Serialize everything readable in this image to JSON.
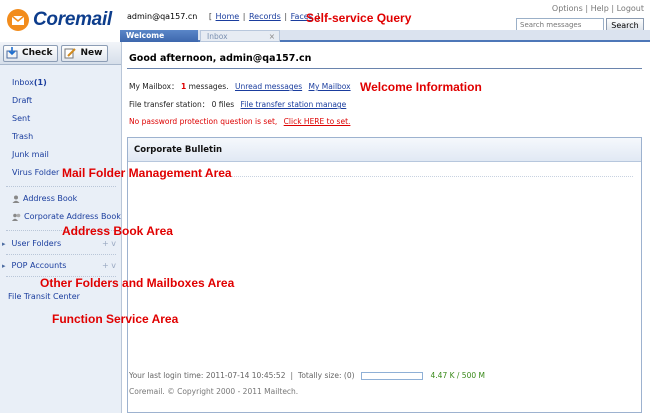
{
  "brand": {
    "name": "Coremail"
  },
  "header": {
    "user": "admin@qa157.cn",
    "links": [
      "Home",
      "Records",
      "Faces"
    ],
    "top_links": [
      "Options",
      "Help",
      "Logout"
    ],
    "search_placeholder": "Search messages",
    "search_button": "Search"
  },
  "tabs": [
    {
      "label": "Welcome",
      "active": true
    },
    {
      "label": "Inbox",
      "active": false,
      "close": "×"
    }
  ],
  "toolbar": {
    "check": "Check",
    "new": "New"
  },
  "sidebar": {
    "folders": [
      {
        "label": "Inbox",
        "count": "(1)"
      },
      {
        "label": "Draft"
      },
      {
        "label": "Sent"
      },
      {
        "label": "Trash"
      },
      {
        "label": "Junk mail"
      },
      {
        "label": "Virus Folder"
      }
    ],
    "address": [
      "Address Book",
      "Corporate Address Book"
    ],
    "user_folders": "User Folders",
    "pop_accounts": "POP Accounts",
    "ctrl": "+ v",
    "file_transit": "File Transit Center"
  },
  "main": {
    "greeting": "Good   afternoon,   admin@qa157.cn",
    "mailbox_prefix": "My Mailbox：",
    "mailbox_count": "1",
    "mailbox_suffix": "messages.",
    "unread_link": "Unread messages",
    "mymailbox_link": "My Mailbox",
    "fts_prefix": "File transfer station：",
    "fts_count": "0 files",
    "fts_link": "File transfer station manage",
    "warning": "No password protection question is set,",
    "warning_link": "Click HERE to set.",
    "bulletin_title": "Corporate   Bulletin",
    "last_login": "Your last login time: 2011-07-14 10:45:52",
    "total_size": "Totally size: (0)",
    "usage": "4.47 K / 500 M",
    "copyright": "Coremail. © Copyright 2000 - 2011 Mailtech."
  },
  "annotations": {
    "self_service": "Self-service Query",
    "welcome_info": "Welcome Information",
    "mail_folder": "Mail Folder Management Area",
    "address_book": "Address Book Area",
    "other_folders": "Other Folders and Mailboxes Area",
    "function_service": "Function Service Area"
  },
  "colors": {
    "annotation": "#e00000",
    "brand": "#0d3d8c",
    "link": "#1a3d9e",
    "accent": "#4d77b8"
  }
}
